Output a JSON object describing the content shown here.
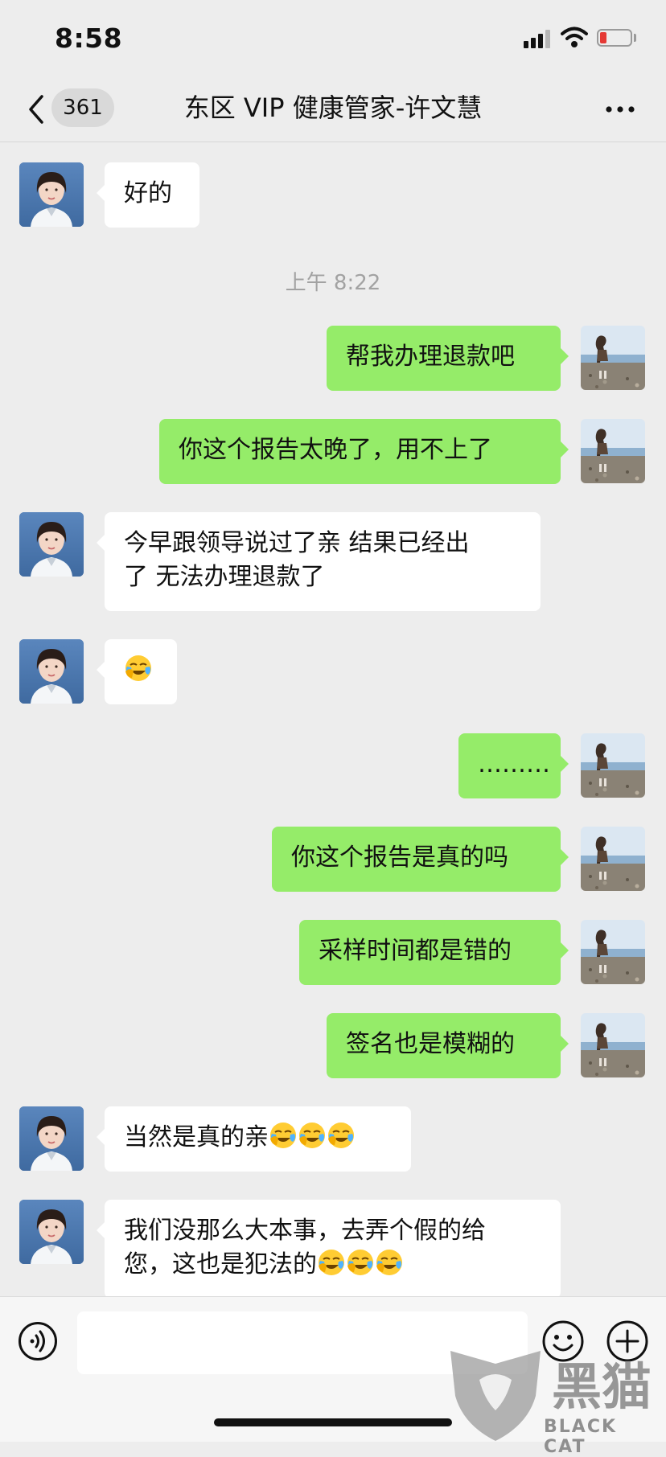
{
  "status_bar": {
    "time": "8:58",
    "battery_color": "#e53935"
  },
  "nav": {
    "unread_count": "361",
    "title": "东区 VIP 健康管家-许文慧",
    "back_icon": "chevron-left-icon",
    "more_icon": "more-dots-icon"
  },
  "timestamp": "上午 8:22",
  "messages": [
    {
      "side": "left",
      "text": "好的"
    },
    {
      "side": "right",
      "text": "帮我办理退款吧"
    },
    {
      "side": "right",
      "text": "你这个报告太晚了，用不上了"
    },
    {
      "side": "left",
      "line1": "今早跟领导说过了亲 结果已经出",
      "line2": "了 无法办理退款了"
    },
    {
      "side": "left",
      "emoji": "crying-laughing-emoji"
    },
    {
      "side": "right",
      "text": "………"
    },
    {
      "side": "right",
      "text": "你这个报告是真的吗"
    },
    {
      "side": "right",
      "text": "采样时间都是错的"
    },
    {
      "side": "right",
      "text": "签名也是模糊的"
    },
    {
      "side": "left",
      "text": "当然是真的亲",
      "emoji_count": 3
    },
    {
      "side": "left",
      "line1": "我们没那么大本事，去弄个假的给",
      "line2": "您，这也是犯法的",
      "emoji_count": 3
    }
  ],
  "input_bar": {
    "placeholder": "",
    "voice_icon": "voice-icon",
    "emoji_icon": "smiley-icon",
    "plus_icon": "plus-circle-icon"
  },
  "watermark": {
    "text": "BLACK CAT",
    "logo_text": "黑猫"
  },
  "colors": {
    "background": "#ededed",
    "sent_bubble": "#95ec69",
    "received_bubble": "#ffffff"
  }
}
